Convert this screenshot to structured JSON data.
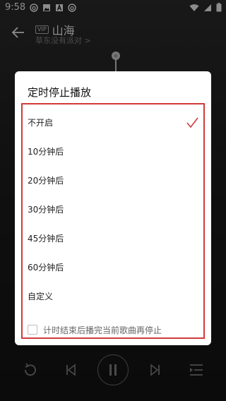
{
  "status_bar": {
    "time": "9:58",
    "left_icons": [
      "netease-icon",
      "image-icon",
      "text-a-icon",
      "netease-icon"
    ],
    "right_icons": [
      "wifi-icon",
      "signal-icon",
      "battery-icon"
    ]
  },
  "header": {
    "vip_badge": "VIP",
    "song_title": "山海",
    "artist": "草东没有派对 >"
  },
  "dialog": {
    "title": "定时停止播放",
    "options": [
      {
        "label": "不开启",
        "selected": true
      },
      {
        "label": "10分钟后",
        "selected": false
      },
      {
        "label": "20分钟后",
        "selected": false
      },
      {
        "label": "30分钟后",
        "selected": false
      },
      {
        "label": "45分钟后",
        "selected": false
      },
      {
        "label": "60分钟后",
        "selected": false
      },
      {
        "label": "自定义",
        "selected": false
      }
    ],
    "footer_checkbox_label": "计时结束后播完当前歌曲再停止",
    "footer_checked": false
  },
  "colors": {
    "accent": "#d13a3a",
    "dialog_bg": "#ffffff",
    "backdrop": "#1f1f1f"
  }
}
